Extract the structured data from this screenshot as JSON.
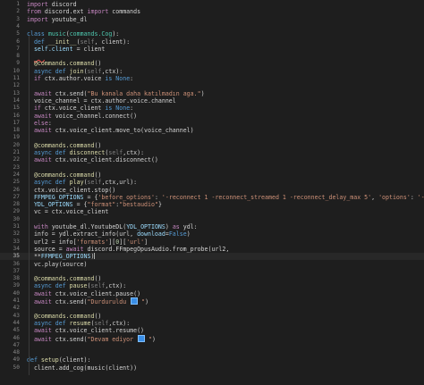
{
  "editor": {
    "current_line": 35,
    "lines": [
      {
        "n": "1",
        "tokens": [
          [
            "kw",
            "import"
          ],
          [
            "pl",
            " discord"
          ]
        ]
      },
      {
        "n": "2",
        "tokens": [
          [
            "kw",
            "from"
          ],
          [
            "pl",
            " discord.ext "
          ],
          [
            "kw",
            "import"
          ],
          [
            "pl",
            " commands"
          ]
        ]
      },
      {
        "n": "3",
        "tokens": [
          [
            "kw",
            "import"
          ],
          [
            "pl",
            " youtube_dl"
          ]
        ]
      },
      {
        "n": "4",
        "tokens": []
      },
      {
        "n": "5",
        "tokens": [
          [
            "def",
            "class"
          ],
          [
            "pl",
            " "
          ],
          [
            "cls",
            "music"
          ],
          [
            "pl",
            "("
          ],
          [
            "cls",
            "commands.Cog"
          ],
          [
            "pl",
            "):"
          ]
        ]
      },
      {
        "n": "6",
        "tokens": [
          [
            "pl",
            "  "
          ],
          [
            "def",
            "def"
          ],
          [
            "pl",
            " "
          ],
          [
            "fn",
            "__init__"
          ],
          [
            "pl",
            "("
          ],
          [
            "dim",
            "self"
          ],
          [
            "pl",
            ", client):"
          ]
        ]
      },
      {
        "n": "7",
        "tokens": [
          [
            "pl",
            "  "
          ],
          [
            "var",
            "self.client"
          ],
          [
            "pl",
            " = client"
          ]
        ]
      },
      {
        "n": "8",
        "tokens": [
          [
            "pl",
            "  "
          ],
          [
            "err",
            ""
          ]
        ]
      },
      {
        "n": "9",
        "tokens": [
          [
            "pl",
            "  "
          ],
          [
            "fn",
            "@commands.command"
          ],
          [
            "pl",
            "()"
          ]
        ]
      },
      {
        "n": "10",
        "tokens": [
          [
            "pl",
            "  "
          ],
          [
            "def",
            "async def"
          ],
          [
            "pl",
            " "
          ],
          [
            "fn",
            "join"
          ],
          [
            "pl",
            "("
          ],
          [
            "dim",
            "self"
          ],
          [
            "pl",
            ",ctx):"
          ]
        ]
      },
      {
        "n": "11",
        "tokens": [
          [
            "pl",
            "  "
          ],
          [
            "kw",
            "if"
          ],
          [
            "pl",
            " ctx.author.voice "
          ],
          [
            "def",
            "is None"
          ],
          [
            "pl",
            ":"
          ]
        ]
      },
      {
        "n": "12",
        "tokens": [
          [
            "pl",
            "  "
          ]
        ]
      },
      {
        "n": "13",
        "tokens": [
          [
            "pl",
            "  "
          ],
          [
            "kw",
            "await"
          ],
          [
            "pl",
            " ctx.send("
          ],
          [
            "str",
            "\"Bu kanala daha katılmadın aga.\""
          ],
          [
            "pl",
            ")"
          ]
        ]
      },
      {
        "n": "14",
        "tokens": [
          [
            "pl",
            "  voice_channel = ctx.author.voice.channel"
          ]
        ]
      },
      {
        "n": "15",
        "tokens": [
          [
            "pl",
            "  "
          ],
          [
            "kw",
            "if"
          ],
          [
            "pl",
            " ctx.voice_client "
          ],
          [
            "def",
            "is None"
          ],
          [
            "pl",
            ":"
          ]
        ]
      },
      {
        "n": "16",
        "tokens": [
          [
            "pl",
            "  "
          ],
          [
            "kw",
            "await"
          ],
          [
            "pl",
            " voice_channel.connect()"
          ]
        ]
      },
      {
        "n": "17",
        "tokens": [
          [
            "pl",
            "  "
          ],
          [
            "kw",
            "else"
          ],
          [
            "pl",
            ":"
          ]
        ]
      },
      {
        "n": "18",
        "tokens": [
          [
            "pl",
            "  "
          ],
          [
            "kw",
            "await"
          ],
          [
            "pl",
            " ctx.voice_client.move_to(voice_channel)"
          ]
        ]
      },
      {
        "n": "19",
        "tokens": []
      },
      {
        "n": "20",
        "tokens": [
          [
            "pl",
            "  "
          ],
          [
            "fn",
            "@commands.command"
          ],
          [
            "pl",
            "()"
          ]
        ]
      },
      {
        "n": "21",
        "tokens": [
          [
            "pl",
            "  "
          ],
          [
            "def",
            "async def"
          ],
          [
            "pl",
            " "
          ],
          [
            "fn",
            "disconnect"
          ],
          [
            "pl",
            "("
          ],
          [
            "dim",
            "self"
          ],
          [
            "pl",
            ",ctx):"
          ]
        ]
      },
      {
        "n": "22",
        "tokens": [
          [
            "pl",
            "  "
          ],
          [
            "kw",
            "await"
          ],
          [
            "pl",
            " ctx.voice_client.disconnect()"
          ]
        ]
      },
      {
        "n": "23",
        "tokens": []
      },
      {
        "n": "24",
        "tokens": [
          [
            "pl",
            "  "
          ],
          [
            "fn",
            "@commands.command"
          ],
          [
            "pl",
            "()"
          ]
        ]
      },
      {
        "n": "25",
        "tokens": [
          [
            "pl",
            "  "
          ],
          [
            "def",
            "async def"
          ],
          [
            "pl",
            " "
          ],
          [
            "fn",
            "play"
          ],
          [
            "pl",
            "("
          ],
          [
            "dim",
            "self"
          ],
          [
            "pl",
            ",ctx,url):"
          ]
        ]
      },
      {
        "n": "26",
        "tokens": [
          [
            "pl",
            "  ctx.voice_client.stop()"
          ]
        ]
      },
      {
        "n": "27",
        "tokens": [
          [
            "pl",
            "  "
          ],
          [
            "var",
            "FFMPEG_OPTIONS"
          ],
          [
            "pl",
            " = {"
          ],
          [
            "str",
            "'before_options'"
          ],
          [
            "pl",
            ": "
          ],
          [
            "str",
            "'-reconnect 1 -reconnect_streamed 1 -reconnect_delay_max 5'"
          ],
          [
            "pl",
            ", "
          ],
          [
            "str",
            "'options'"
          ],
          [
            "pl",
            ": "
          ],
          [
            "str",
            "'-vn'"
          ],
          [
            "pl",
            "}"
          ]
        ]
      },
      {
        "n": "28",
        "tokens": [
          [
            "pl",
            "  "
          ],
          [
            "var",
            "YDL_OPTIONS"
          ],
          [
            "pl",
            " = {"
          ],
          [
            "str",
            "\"format\""
          ],
          [
            "pl",
            ":"
          ],
          [
            "str",
            "\"bestaudio\""
          ],
          [
            "pl",
            "}"
          ]
        ]
      },
      {
        "n": "29",
        "tokens": [
          [
            "pl",
            "  vc = ctx.voice_client"
          ]
        ]
      },
      {
        "n": "30",
        "tokens": []
      },
      {
        "n": "31",
        "tokens": [
          [
            "pl",
            "  "
          ],
          [
            "kw",
            "with"
          ],
          [
            "pl",
            " youtube_dl.YoutubeDL("
          ],
          [
            "var",
            "YDL_OPTIONS"
          ],
          [
            "pl",
            ") "
          ],
          [
            "kw",
            "as"
          ],
          [
            "pl",
            " ydl:"
          ]
        ]
      },
      {
        "n": "32",
        "tokens": [
          [
            "pl",
            "  info = ydl.extract_info(url, "
          ],
          [
            "var",
            "download"
          ],
          [
            "pl",
            "="
          ],
          [
            "def",
            "False"
          ],
          [
            "pl",
            ")"
          ]
        ]
      },
      {
        "n": "33",
        "tokens": [
          [
            "pl",
            "  url2 = info["
          ],
          [
            "str",
            "'formats'"
          ],
          [
            "pl",
            "]["
          ],
          [
            "num",
            "0"
          ],
          [
            "pl",
            "]["
          ],
          [
            "str",
            "'url'"
          ],
          [
            "pl",
            "]"
          ]
        ]
      },
      {
        "n": "34",
        "tokens": [
          [
            "pl",
            "  source = "
          ],
          [
            "kw",
            "await"
          ],
          [
            "pl",
            " discord.FFmpegOpusAudio.from_probe(url2,"
          ]
        ]
      },
      {
        "n": "35",
        "tokens": [
          [
            "pl",
            "  **"
          ],
          [
            "var",
            "FFMPEG_OPTIONS"
          ],
          [
            "pl",
            ")"
          ]
        ]
      },
      {
        "n": "36",
        "tokens": [
          [
            "pl",
            "  vc.play(source)"
          ]
        ]
      },
      {
        "n": "37",
        "tokens": []
      },
      {
        "n": "38",
        "tokens": [
          [
            "pl",
            "  "
          ],
          [
            "fn",
            "@commands.command"
          ],
          [
            "pl",
            "()"
          ]
        ]
      },
      {
        "n": "39",
        "tokens": [
          [
            "pl",
            "  "
          ],
          [
            "def",
            "async def"
          ],
          [
            "pl",
            " "
          ],
          [
            "fn",
            "pause"
          ],
          [
            "pl",
            "("
          ],
          [
            "dim",
            "self"
          ],
          [
            "pl",
            ",ctx):"
          ]
        ]
      },
      {
        "n": "40",
        "tokens": [
          [
            "pl",
            "  "
          ],
          [
            "kw",
            "await"
          ],
          [
            "pl",
            " ctx.voice_client.pause()"
          ]
        ]
      },
      {
        "n": "41",
        "tokens": [
          [
            "pl",
            "  "
          ],
          [
            "kw",
            "await"
          ],
          [
            "pl",
            " ctx.send("
          ],
          [
            "str",
            "\"Durduruldu "
          ],
          [
            "emoji",
            ""
          ],
          [
            "str",
            " \""
          ],
          [
            "pl",
            ")"
          ]
        ]
      },
      {
        "n": "42",
        "tokens": []
      },
      {
        "n": "43",
        "tokens": [
          [
            "pl",
            "  "
          ],
          [
            "fn",
            "@commands.command"
          ],
          [
            "pl",
            "()"
          ]
        ]
      },
      {
        "n": "44",
        "tokens": [
          [
            "pl",
            "  "
          ],
          [
            "def",
            "async def"
          ],
          [
            "pl",
            " "
          ],
          [
            "fn",
            "resume"
          ],
          [
            "pl",
            "("
          ],
          [
            "dim",
            "self"
          ],
          [
            "pl",
            ",ctx):"
          ]
        ]
      },
      {
        "n": "45",
        "tokens": [
          [
            "pl",
            "  "
          ],
          [
            "kw",
            "await"
          ],
          [
            "pl",
            " ctx.voice_client.resume()"
          ]
        ]
      },
      {
        "n": "46",
        "tokens": [
          [
            "pl",
            "  "
          ],
          [
            "kw",
            "await"
          ],
          [
            "pl",
            " ctx.send("
          ],
          [
            "str",
            "\"Devam ediyor "
          ],
          [
            "emoji",
            ""
          ],
          [
            "str",
            " \""
          ],
          [
            "pl",
            ")"
          ]
        ]
      },
      {
        "n": "47",
        "tokens": []
      },
      {
        "n": "48",
        "tokens": []
      },
      {
        "n": "49",
        "tokens": [
          [
            "def",
            "def"
          ],
          [
            "pl",
            " "
          ],
          [
            "fn",
            "setup"
          ],
          [
            "pl",
            "(client):"
          ]
        ]
      },
      {
        "n": "50",
        "tokens": [
          [
            "pl",
            "  client.add_cog(music(client))"
          ]
        ]
      }
    ]
  }
}
